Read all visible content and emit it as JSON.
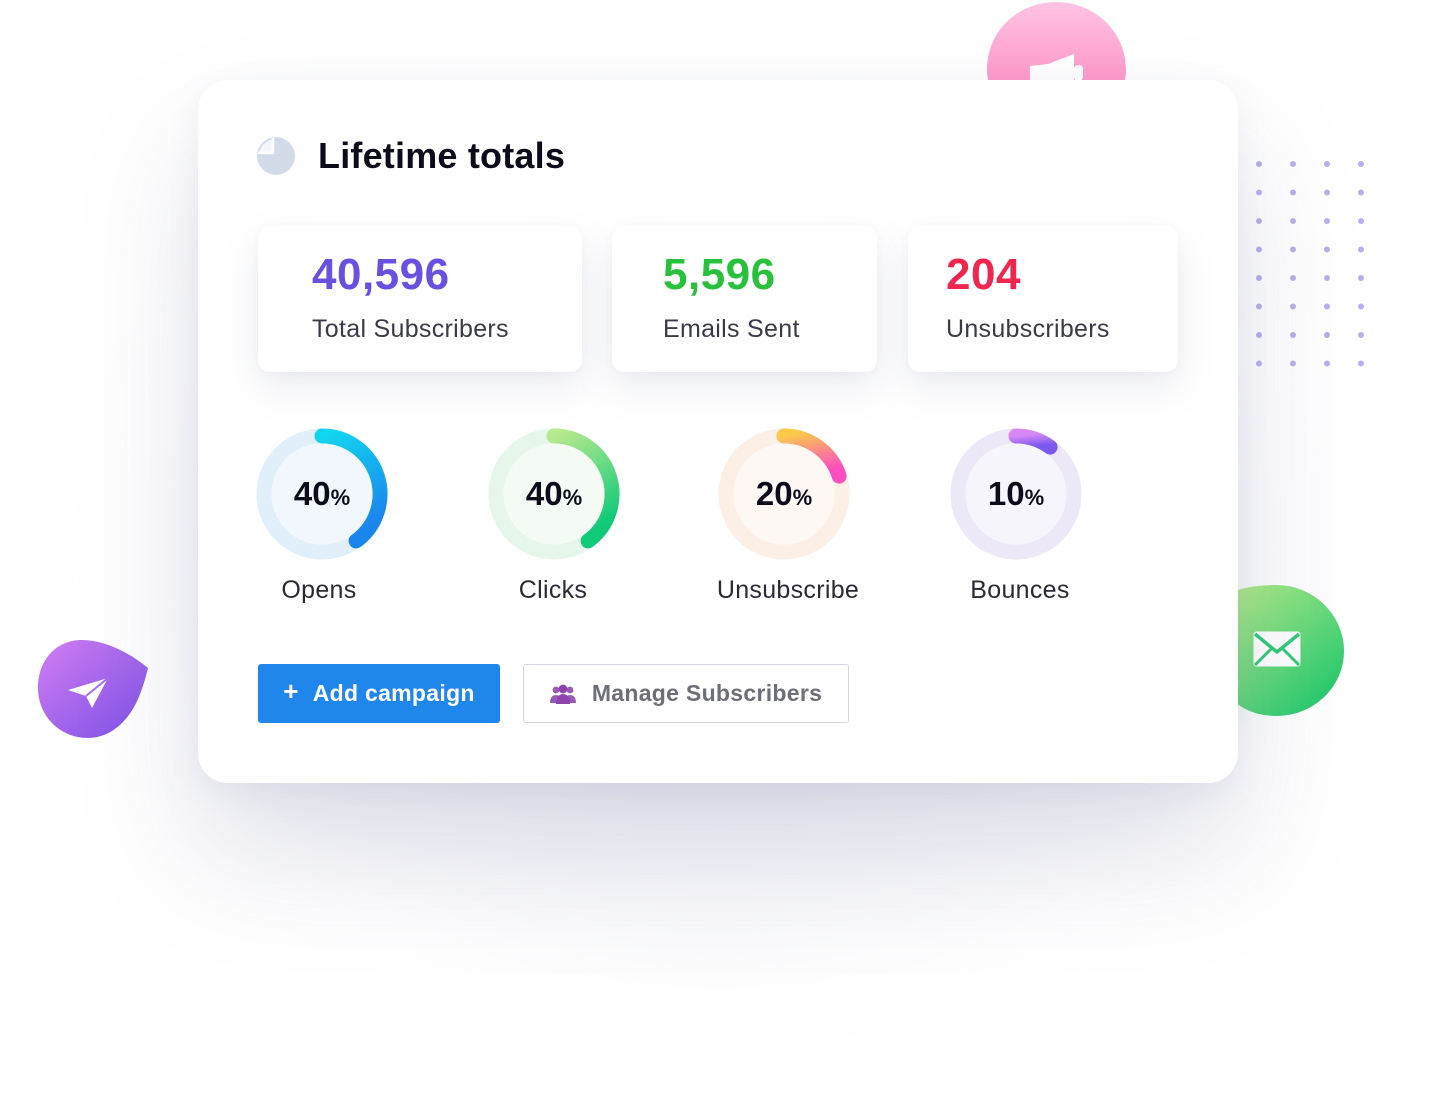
{
  "title": "Lifetime totals",
  "stats": [
    {
      "value": "40,596",
      "label": "Total Subscribers",
      "color": "#6a4fe0"
    },
    {
      "value": "5,596",
      "label": "Emails Sent",
      "color": "#29c13c"
    },
    {
      "value": "204",
      "label": "Unsubscribers",
      "color": "#f0264f"
    }
  ],
  "metrics": [
    {
      "value": "40",
      "unit": "%",
      "label": "Opens",
      "percent": 40,
      "track": "#e1effb",
      "inner": "#f1f7fd",
      "from": "#12d6f0",
      "to": "#1a86ec"
    },
    {
      "value": "40",
      "unit": "%",
      "label": "Clicks",
      "percent": 40,
      "track": "#e6f6ea",
      "inner": "#f4fbf5",
      "from": "#b7e98e",
      "to": "#10ca7a"
    },
    {
      "value": "20",
      "unit": "%",
      "label": "Unsubscribe",
      "percent": 20,
      "track": "#fcefe6",
      "inner": "#fef8f4",
      "from": "#fbc94a",
      "to": "#fb4fc2"
    },
    {
      "value": "10",
      "unit": "%",
      "label": "Bounces",
      "percent": 10,
      "track": "#ece8f8",
      "inner": "#f7f5fc",
      "from": "#d888f6",
      "to": "#7b58ee"
    }
  ],
  "actions": {
    "add_campaign": "Add campaign",
    "add_icon": "+",
    "manage_subscribers": "Manage Subscribers"
  },
  "icons": {
    "title": "pie-chart-icon",
    "megaphone": "megaphone-icon",
    "mail": "mail-icon",
    "send": "paper-plane-icon",
    "users": "users-icon"
  }
}
